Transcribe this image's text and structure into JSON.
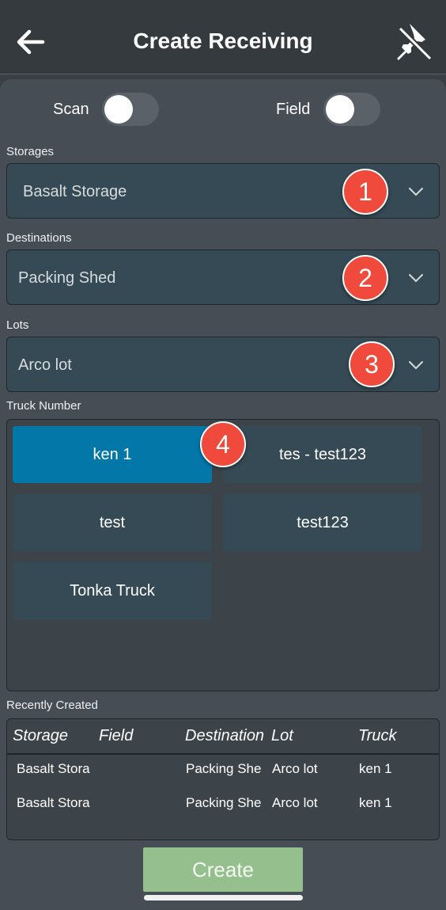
{
  "header": {
    "title": "Create Receiving",
    "back_icon": "arrow-left-icon",
    "pin_icon": "pin-slash-icon"
  },
  "toggles": {
    "scan_label": "Scan",
    "field_label": "Field"
  },
  "storages": {
    "label": "Storages",
    "value": "Basalt Storage",
    "badge": "1"
  },
  "destinations": {
    "label": "Destinations",
    "value": "Packing Shed",
    "badge": "2"
  },
  "lots": {
    "label": "Lots",
    "value": "Arco lot",
    "badge": "3"
  },
  "truck": {
    "label": "Truck Number",
    "badge": "4",
    "options": [
      "ken 1",
      "tes - test123",
      "test",
      "test123",
      "Tonka Truck"
    ],
    "selected": "ken 1"
  },
  "recent": {
    "label": "Recently Created",
    "columns": [
      "Storage",
      "Field",
      "Destination",
      "Lot",
      "Truck"
    ],
    "rows": [
      [
        "Basalt Stora",
        "",
        "Packing She",
        "Arco lot",
        "ken 1"
      ],
      [
        "Basalt Stora",
        "",
        "Packing She",
        "Arco lot",
        "ken 1"
      ]
    ]
  },
  "create_label": "Create",
  "colors": {
    "accent_selected": "#0277a8",
    "badge": "#ef4a3b",
    "create_button": "#95c08d",
    "field_bg": "#354a54"
  }
}
